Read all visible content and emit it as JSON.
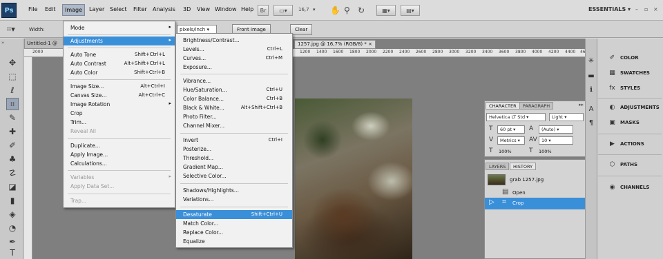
{
  "app": {
    "logo": "Ps",
    "menus": [
      "File",
      "Edit",
      "Image",
      "Layer",
      "Select",
      "Filter",
      "Analysis",
      "3D",
      "View",
      "Window",
      "Help"
    ],
    "zoom": "16,7",
    "workspace": "ESSENTIALS ▾",
    "win_controls": [
      "–",
      "▫",
      "×"
    ]
  },
  "options": {
    "width_label": "Width:",
    "units": "pixels/inch",
    "front_image": "Front Image",
    "clear": "Clear"
  },
  "document": {
    "tab1": "Untitled-1 @",
    "tab2": "1257.jpg @ 16,7% (RGB/8) * ×",
    "ruler_marks": [
      "2000",
      "1200",
      "1400",
      "1600",
      "1800",
      "2000",
      "2200",
      "2400",
      "2600",
      "2800",
      "3000",
      "3200",
      "3400",
      "3600",
      "3800",
      "4000",
      "4200",
      "4400",
      "46"
    ]
  },
  "image_menu": [
    {
      "label": "Mode",
      "arrow": "▸",
      "disabled": false
    },
    {
      "label": "Adjustments",
      "arrow": "▸",
      "highlight": true
    },
    {
      "label": "Auto Tone",
      "shortcut": "Shift+Ctrl+L"
    },
    {
      "label": "Auto Contrast",
      "shortcut": "Alt+Shift+Ctrl+L"
    },
    {
      "label": "Auto Color",
      "shortcut": "Shift+Ctrl+B"
    },
    {
      "label": "Image Size...",
      "shortcut": "Alt+Ctrl+I"
    },
    {
      "label": "Canvas Size...",
      "shortcut": "Alt+Ctrl+C"
    },
    {
      "label": "Image Rotation",
      "arrow": "▸"
    },
    {
      "label": "Crop"
    },
    {
      "label": "Trim..."
    },
    {
      "label": "Reveal All",
      "disabled": true
    },
    {
      "label": "Duplicate..."
    },
    {
      "label": "Apply Image..."
    },
    {
      "label": "Calculations..."
    },
    {
      "label": "Variables",
      "arrow": "▸",
      "disabled": true
    },
    {
      "label": "Apply Data Set...",
      "disabled": true
    },
    {
      "label": "Trap...",
      "disabled": true
    }
  ],
  "adjust_menu": [
    {
      "label": "Brightness/Contrast..."
    },
    {
      "label": "Levels...",
      "shortcut": "Ctrl+L"
    },
    {
      "label": "Curves...",
      "shortcut": "Ctrl+M"
    },
    {
      "label": "Exposure..."
    },
    {
      "label": "Vibrance..."
    },
    {
      "label": "Hue/Saturation...",
      "shortcut": "Ctrl+U"
    },
    {
      "label": "Color Balance...",
      "shortcut": "Ctrl+B"
    },
    {
      "label": "Black & White...",
      "shortcut": "Alt+Shift+Ctrl+B"
    },
    {
      "label": "Photo Filter..."
    },
    {
      "label": "Channel Mixer..."
    },
    {
      "label": "Invert",
      "shortcut": "Ctrl+I"
    },
    {
      "label": "Posterize..."
    },
    {
      "label": "Threshold..."
    },
    {
      "label": "Gradient Map..."
    },
    {
      "label": "Selective Color..."
    },
    {
      "label": "Shadows/Highlights..."
    },
    {
      "label": "Variations..."
    },
    {
      "label": "Desaturate",
      "shortcut": "Shift+Ctrl+U",
      "highlight": true
    },
    {
      "label": "Match Color..."
    },
    {
      "label": "Replace Color..."
    },
    {
      "label": "Equalize"
    }
  ],
  "character": {
    "tab_character": "CHARACTER",
    "tab_paragraph": "PARAGRAPH",
    "font": "Helvetica LT Std",
    "style": "Light",
    "size": "60 pt",
    "leading": "(Auto)",
    "kerning": "Metrics",
    "tracking": "10",
    "scale_v": "100%",
    "scale_h": "100%"
  },
  "history": {
    "tab_layers": "LAYERS",
    "tab_history": "HISTORY",
    "snapshot": "grab 1257.jpg",
    "steps": [
      {
        "label": "Open"
      },
      {
        "label": "Crop",
        "selected": true
      }
    ]
  },
  "dock": [
    {
      "icon": "color-icon",
      "label": "COLOR"
    },
    {
      "icon": "swatches-icon",
      "label": "SWATCHES"
    },
    {
      "icon": "styles-icon",
      "label": "STYLES"
    },
    {
      "icon": "adjustments-icon",
      "label": "ADJUSTMENTS"
    },
    {
      "icon": "masks-icon",
      "label": "MASKS"
    },
    {
      "icon": "actions-icon",
      "label": "ACTIONS"
    },
    {
      "icon": "paths-icon",
      "label": "PATHS"
    },
    {
      "icon": "channels-icon",
      "label": "CHANNELS"
    }
  ]
}
